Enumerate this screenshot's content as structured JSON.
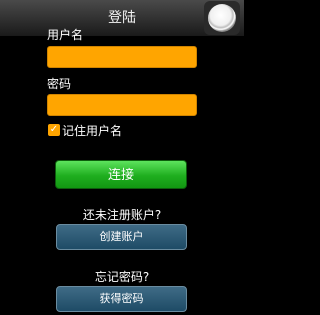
{
  "header": {
    "title": "登陆"
  },
  "form": {
    "username_label": "用户名",
    "password_label": "密码",
    "username_value": "",
    "password_value": "",
    "remember_label": "记住用户名",
    "remember_checked": true,
    "connect_label": "连接"
  },
  "register": {
    "prompt": "还未注册账户?",
    "button_label": "创建账户"
  },
  "forgot": {
    "prompt": "忘记密码?",
    "button_label": "获得密码"
  },
  "icons": {
    "top_right": "circle-button-icon",
    "checkbox": "checkmark-icon"
  },
  "colors": {
    "field": "#ffa500",
    "connect": "#1fae1f",
    "secondary_button": "#2a5a78"
  }
}
